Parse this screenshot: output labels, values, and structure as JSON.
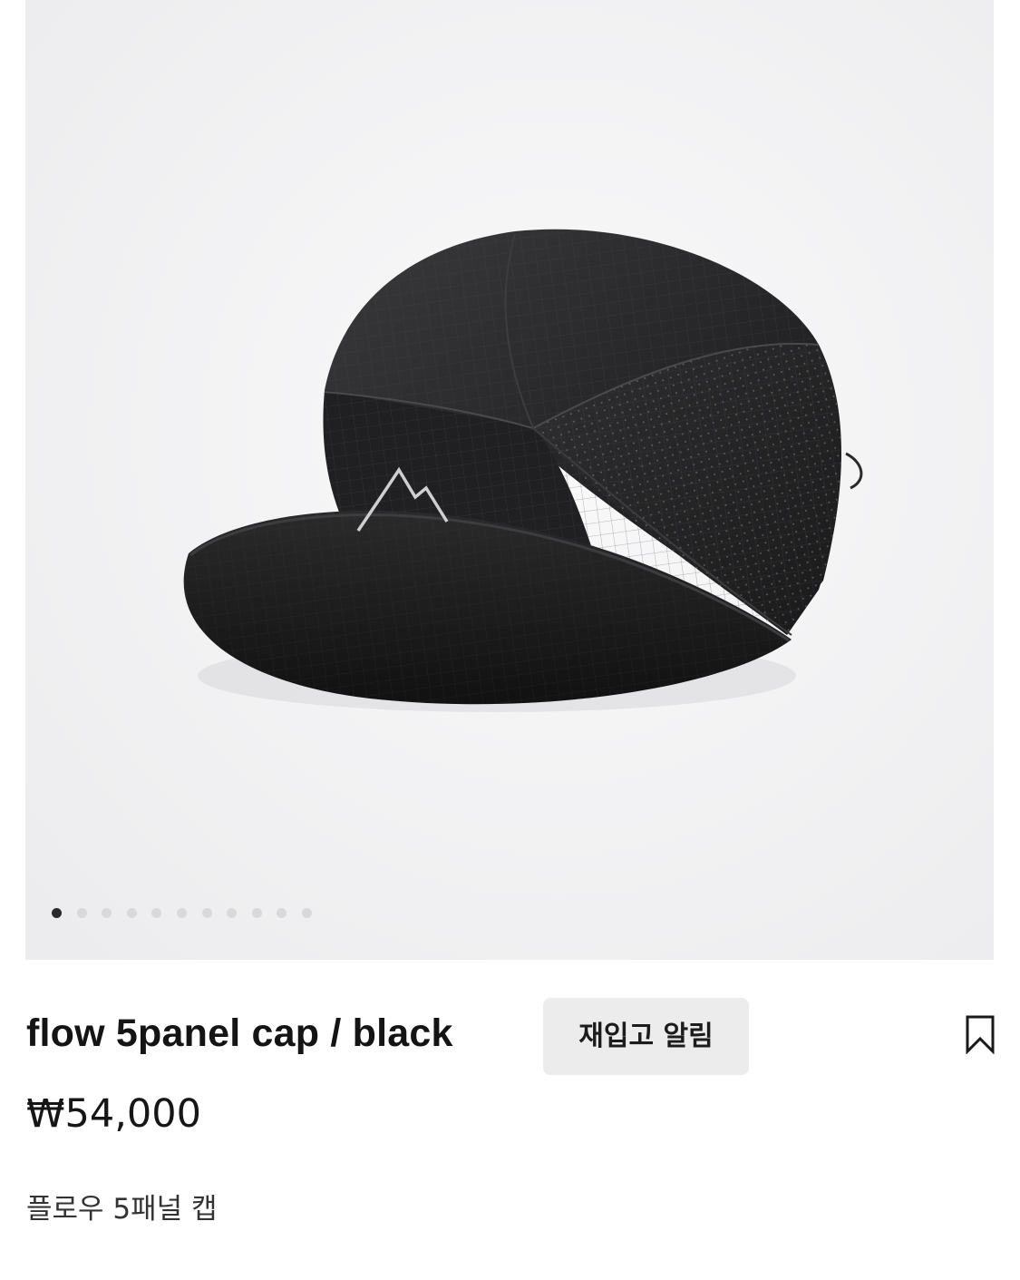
{
  "gallery": {
    "image_alt": "black 5 panel cap with mountain logo",
    "slide_count": 11,
    "active_index": 0
  },
  "product": {
    "title": "flow 5panel cap / black",
    "price": "₩54,000",
    "korean_name": "플로우 5패널 캡"
  },
  "actions": {
    "restock_label": "재입고 알림",
    "bookmark_icon": "bookmark-icon"
  },
  "colors": {
    "button_bg": "#ececec",
    "active_dot": "#2a2a2a",
    "inactive_dot": "#d9d9db"
  }
}
